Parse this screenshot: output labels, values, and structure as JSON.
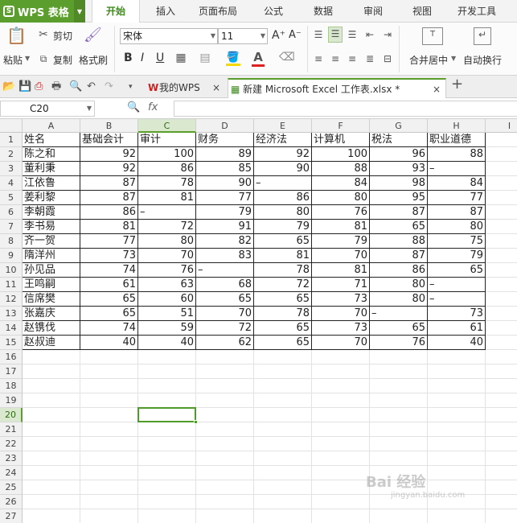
{
  "app": {
    "logo_text": "WPS 表格",
    "logo_mark": "S"
  },
  "menu": {
    "items": [
      "开始",
      "插入",
      "页面布局",
      "公式",
      "数据",
      "审阅",
      "视图",
      "开发工具"
    ],
    "active": "开始"
  },
  "ribbon": {
    "paste_label": "粘贴",
    "cut_label": "剪切",
    "copy_label": "复制",
    "format_painter_label": "格式刷",
    "font_name": "宋体",
    "font_size": "11",
    "merge_center_label": "合并居中",
    "wrap_text_label": "自动换行",
    "bold": "B",
    "italic": "I",
    "underline": "U",
    "font_grow": "A⁺",
    "font_shrink": "A⁻",
    "font_color_letter": "A",
    "accent_color": "#5c9e2e",
    "font_color": "#e02020",
    "fill_color": "#f5d800"
  },
  "tabs": [
    {
      "label": "我的WPS",
      "active": false
    },
    {
      "label": "新建 Microsoft Excel 工作表.xlsx *",
      "active": true
    }
  ],
  "new_tab_glyph": "+",
  "formula_bar": {
    "name_box": "C20",
    "fx": "fx",
    "value": ""
  },
  "sheet": {
    "columns": [
      "A",
      "B",
      "C",
      "D",
      "E",
      "F",
      "G",
      "H",
      "I"
    ],
    "row_numbers": [
      1,
      2,
      3,
      4,
      5,
      6,
      7,
      8,
      9,
      10,
      11,
      12,
      13,
      14,
      15,
      16,
      17,
      18,
      19,
      20,
      21,
      22,
      23,
      24,
      25,
      26,
      27
    ],
    "selected_cell": "C20",
    "selected_column": "C",
    "selected_row": 20,
    "data": [
      [
        "姓名",
        "基础会计",
        "审计",
        "财务",
        "经济法",
        "计算机",
        "税法",
        "职业道德"
      ],
      [
        "陈之和",
        "92",
        "100",
        "89",
        "92",
        "100",
        "96",
        "88"
      ],
      [
        "董利秉",
        "92",
        "86",
        "85",
        "90",
        "88",
        "93",
        "–"
      ],
      [
        "江依鲁",
        "87",
        "78",
        "90",
        "–",
        "84",
        "98",
        "84"
      ],
      [
        "姜利黎",
        "87",
        "81",
        "77",
        "86",
        "80",
        "95",
        "77"
      ],
      [
        "李朝霞",
        "86",
        "–",
        "79",
        "80",
        "76",
        "87",
        "87"
      ],
      [
        "李书易",
        "81",
        "72",
        "91",
        "79",
        "81",
        "65",
        "80"
      ],
      [
        "齐一贺",
        "77",
        "80",
        "82",
        "65",
        "79",
        "88",
        "75"
      ],
      [
        "隋洋州",
        "73",
        "70",
        "83",
        "81",
        "70",
        "87",
        "79"
      ],
      [
        "孙见品",
        "74",
        "76",
        "–",
        "78",
        "81",
        "86",
        "65"
      ],
      [
        "王鸣嗣",
        "61",
        "63",
        "68",
        "72",
        "71",
        "80",
        "–"
      ],
      [
        "信席樊",
        "65",
        "60",
        "65",
        "65",
        "73",
        "80",
        "–"
      ],
      [
        "张嘉庆",
        "65",
        "51",
        "70",
        "78",
        "70",
        "–",
        "73"
      ],
      [
        "赵镌伐",
        "74",
        "59",
        "72",
        "65",
        "73",
        "65",
        "61"
      ],
      [
        "赵叔迪",
        "40",
        "40",
        "62",
        "65",
        "70",
        "76",
        "40"
      ]
    ]
  },
  "watermark": {
    "text": "Bai 经验",
    "sub": "jingyan.baidu.com"
  }
}
